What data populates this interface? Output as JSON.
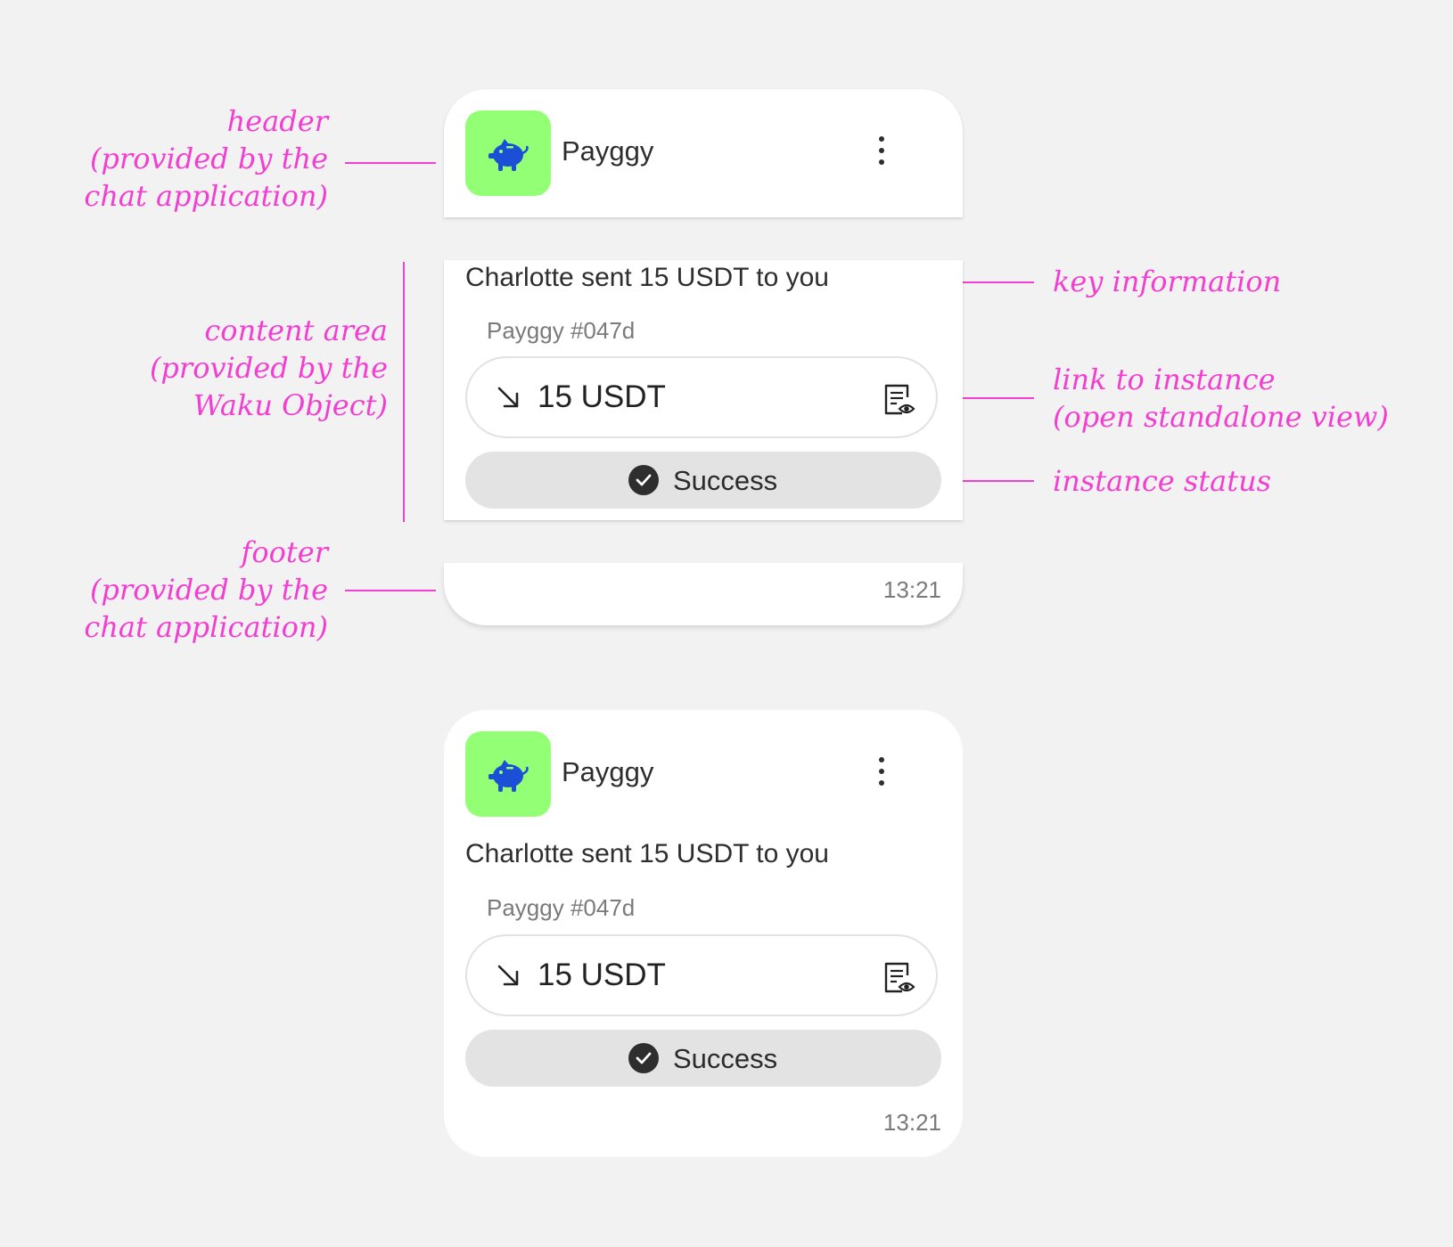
{
  "annotations": {
    "header": [
      "header",
      "(provided by the",
      "chat application)"
    ],
    "content": [
      "content area",
      "(provided by the",
      "Waku Object)"
    ],
    "footer": [
      "footer",
      "(provided by the",
      "chat application)"
    ],
    "key_information": "key information",
    "link": [
      "link to instance",
      "(open standalone view)"
    ],
    "status": "instance status"
  },
  "exploded": {
    "header": {
      "app_name": "Payggy",
      "icon": "piggy-bank-icon",
      "menu_icon": "more-vertical-icon"
    },
    "content": {
      "key_information": "Charlotte sent 15 USDT to you",
      "instance_name": "Payggy #047d",
      "link": {
        "direction_icon": "arrow-down-right-icon",
        "amount": "15 USDT",
        "view_icon": "document-view-icon"
      },
      "status": {
        "icon": "check-circle-icon",
        "label": "Success"
      }
    },
    "footer": {
      "time": "13:21"
    }
  },
  "assembled": {
    "header": {
      "app_name": "Payggy",
      "icon": "piggy-bank-icon",
      "menu_icon": "more-vertical-icon"
    },
    "content": {
      "key_information": "Charlotte sent 15 USDT to you",
      "instance_name": "Payggy #047d",
      "link": {
        "direction_icon": "arrow-down-right-icon",
        "amount": "15 USDT",
        "view_icon": "document-view-icon"
      },
      "status": {
        "icon": "check-circle-icon",
        "label": "Success"
      }
    },
    "footer": {
      "time": "13:21"
    }
  },
  "colors": {
    "annotation": "#f23ed1",
    "background": "#f2f2f2",
    "app_icon_bg": "#93ff75",
    "app_icon_fg": "#1b4fd6",
    "status_bg": "#e3e3e3"
  }
}
